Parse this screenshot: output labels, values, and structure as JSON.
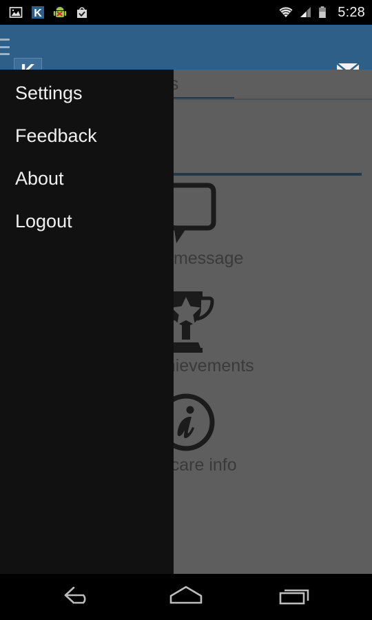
{
  "status_bar": {
    "time": "5:28",
    "left_icons": [
      {
        "name": "gallery-icon",
        "label": "Gallery"
      },
      {
        "name": "app-k-icon",
        "label": "K"
      },
      {
        "name": "android-error-icon",
        "label": "Android"
      },
      {
        "name": "play-store-icon",
        "label": "Play Store"
      }
    ],
    "right_icons": [
      {
        "name": "wifi-icon",
        "label": "Wi-Fi"
      },
      {
        "name": "signal-icon",
        "label": "Signal"
      },
      {
        "name": "battery-icon",
        "label": "Battery"
      }
    ]
  },
  "app_bar": {
    "menu_label": "Open navigation drawer",
    "logo_text": "K",
    "mail_label": "Messages",
    "background_color": "#2d5f88"
  },
  "drawer": {
    "background_color": "#111111",
    "items": [
      {
        "label": "Settings",
        "name": "drawer-item-settings"
      },
      {
        "label": "Feedback",
        "name": "drawer-item-feedback"
      },
      {
        "label": "About",
        "name": "drawer-item-about"
      },
      {
        "label": "Logout",
        "name": "drawer-item-logout"
      }
    ]
  },
  "content": {
    "background_color": "#5e5e5e",
    "tab": {
      "label": "athias",
      "full_label": "Mathias",
      "indicator_color": "#23384a"
    },
    "divider_color": "#23384a",
    "actions": [
      {
        "label": "Send message",
        "icon": "speech-bubble-icon",
        "name": "action-send-message"
      },
      {
        "label": "Big achievements",
        "icon": "trophy-icon",
        "name": "action-big-achievements"
      },
      {
        "label": "Day care info",
        "icon": "info-circle-icon",
        "name": "action-day-care-info"
      }
    ]
  },
  "nav_bar": {
    "buttons": [
      {
        "name": "nav-back-button",
        "label": "Back",
        "icon": "back-arrow-icon"
      },
      {
        "name": "nav-home-button",
        "label": "Home",
        "icon": "home-icon"
      },
      {
        "name": "nav-recents-button",
        "label": "Recents",
        "icon": "recents-icon"
      }
    ]
  }
}
